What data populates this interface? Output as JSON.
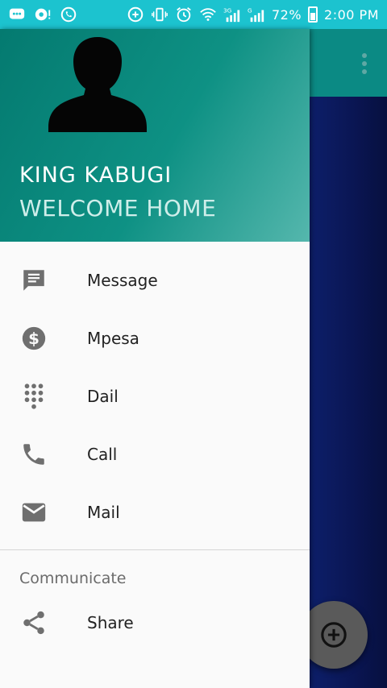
{
  "status_bar": {
    "battery": "72%",
    "time": "2:00 PM",
    "signal_3g": "3G",
    "signal_g": "G"
  },
  "drawer": {
    "header": {
      "name": "KING KABUGI",
      "subtitle": "WELCOME HOME"
    },
    "items": [
      {
        "label": "Message",
        "icon": "message-icon"
      },
      {
        "label": "Mpesa",
        "icon": "dollar-circle-icon"
      },
      {
        "label": "Dail",
        "icon": "dialpad-icon"
      },
      {
        "label": "Call",
        "icon": "phone-icon"
      },
      {
        "label": "Mail",
        "icon": "mail-icon"
      }
    ],
    "section_title": "Communicate",
    "section_items": [
      {
        "label": "Share",
        "icon": "share-icon"
      }
    ]
  },
  "colors": {
    "status_bar": "#1cc3cf",
    "header_start": "#047a70",
    "header_end": "#55b7ad",
    "icon": "#6f6f6f",
    "app_bg": "#0a1552",
    "fab": "#5a5a5a"
  }
}
